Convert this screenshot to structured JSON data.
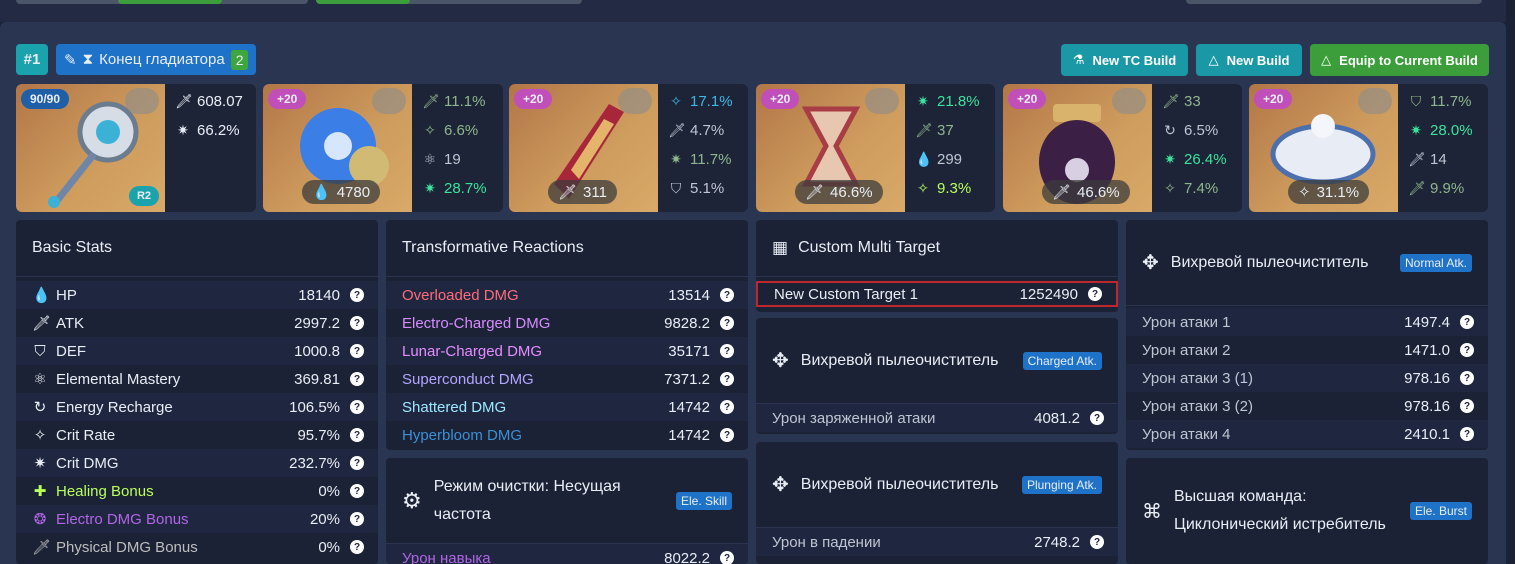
{
  "header": {
    "rank": "#1",
    "set_name": "Конец гладиатора",
    "set_count": "2",
    "buttons": {
      "new_tc": "New TC Build",
      "new_build": "New Build",
      "equip": "Equip to Current Build"
    }
  },
  "weapon": {
    "level": "90/90",
    "refine": "R2",
    "atk": "608.07",
    "crit_dmg": "66.2%"
  },
  "artifacts": [
    {
      "level": "+20",
      "main": "4780",
      "subs": [
        "11.1%",
        "6.6%",
        "19",
        "28.7%"
      ]
    },
    {
      "level": "+20",
      "main": "311",
      "subs": [
        "17.1%",
        "4.7%",
        "11.7%",
        "5.1%"
      ]
    },
    {
      "level": "+20",
      "main": "46.6%",
      "subs": [
        "21.8%",
        "37",
        "299",
        "9.3%"
      ]
    },
    {
      "level": "+20",
      "main": "46.6%",
      "subs": [
        "33",
        "6.5%",
        "26.4%",
        "7.4%"
      ]
    },
    {
      "level": "+20",
      "main": "31.1%",
      "subs": [
        "11.7%",
        "28.0%",
        "14",
        "9.9%"
      ]
    }
  ],
  "basic_stats": {
    "title": "Basic Stats",
    "rows": [
      {
        "label": "HP",
        "value": "18140"
      },
      {
        "label": "ATK",
        "value": "2997.2"
      },
      {
        "label": "DEF",
        "value": "1000.8"
      },
      {
        "label": "Elemental Mastery",
        "value": "369.81"
      },
      {
        "label": "Energy Recharge",
        "value": "106.5%"
      },
      {
        "label": "Crit Rate",
        "value": "95.7%"
      },
      {
        "label": "Crit DMG",
        "value": "232.7%"
      },
      {
        "label": "Healing Bonus",
        "value": "0%"
      },
      {
        "label": "Electro DMG Bonus",
        "value": "20%"
      },
      {
        "label": "Physical DMG Bonus",
        "value": "0%"
      }
    ]
  },
  "transformative": {
    "title": "Transformative Reactions",
    "rows": [
      {
        "label": "Overloaded DMG",
        "value": "13514"
      },
      {
        "label": "Electro-Charged DMG",
        "value": "9828.2"
      },
      {
        "label": "Lunar-Charged DMG",
        "value": "35171"
      },
      {
        "label": "Superconduct DMG",
        "value": "7371.2"
      },
      {
        "label": "Shattered DMG",
        "value": "14742"
      },
      {
        "label": "Hyperbloom DMG",
        "value": "14742"
      }
    ]
  },
  "skill": {
    "title": "Режим очистки: Несущая частота",
    "tag": "Ele. Skill",
    "row_label": "Урон навыка",
    "row_value": "8022.2"
  },
  "custom": {
    "title": "Custom Multi Target",
    "target_label": "New Custom Target 1",
    "target_value": "1252490"
  },
  "charged": {
    "title": "Вихревой пылеочиститель",
    "tag": "Charged Atk.",
    "row_label": "Урон заряженной атаки",
    "row_value": "4081.2"
  },
  "plunging": {
    "title": "Вихревой пылеочиститель",
    "tag": "Plunging Atk.",
    "row_label": "Урон в падении",
    "row_value": "2748.2"
  },
  "normal": {
    "title": "Вихревой пылеочиститель",
    "tag": "Normal Atk.",
    "rows": [
      {
        "label": "Урон атаки 1",
        "value": "1497.4"
      },
      {
        "label": "Урон атаки 2",
        "value": "1471.0"
      },
      {
        "label": "Урон атаки 3 (1)",
        "value": "978.16"
      },
      {
        "label": "Урон атаки 3 (2)",
        "value": "978.16"
      },
      {
        "label": "Урон атаки 4",
        "value": "2410.1"
      }
    ]
  },
  "burst": {
    "title": "Высшая команда: Циклонический истребитель",
    "tag": "Ele. Burst"
  },
  "colors": {
    "overloaded": "#ff6b7a",
    "electro": "#d68cff",
    "superconduct": "#b3a5ff",
    "shattered": "#9ee8ff",
    "hyperbloom": "#3d8fd6",
    "healing": "#b8ff5b",
    "electro_bonus": "#b265e6",
    "physical": "#bdbdbd",
    "crit_green": "#3be39a"
  }
}
